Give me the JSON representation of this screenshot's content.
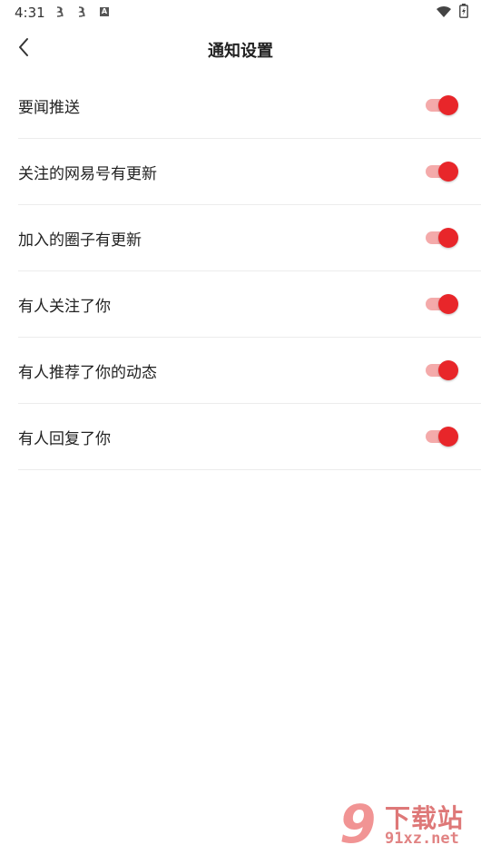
{
  "status_bar": {
    "time": "4:31",
    "left_icons": [
      "notification-icon",
      "notification-icon",
      "a-badge-icon"
    ],
    "right_icons": [
      "wifi-icon",
      "battery-icon"
    ]
  },
  "header": {
    "back_icon": "chevron-left-icon",
    "title": "通知设置"
  },
  "settings": [
    {
      "label": "要闻推送",
      "enabled": true
    },
    {
      "label": "关注的网易号有更新",
      "enabled": true
    },
    {
      "label": "加入的圈子有更新",
      "enabled": true
    },
    {
      "label": "有人关注了你",
      "enabled": true
    },
    {
      "label": "有人推荐了你的动态",
      "enabled": true
    },
    {
      "label": "有人回复了你",
      "enabled": true
    }
  ],
  "colors": {
    "accent": "#e8262a",
    "track_on": "#f4aaaa",
    "divider": "#ececec"
  },
  "watermark": {
    "logo": "9",
    "title": "下载站",
    "domain": "91xz.net"
  }
}
